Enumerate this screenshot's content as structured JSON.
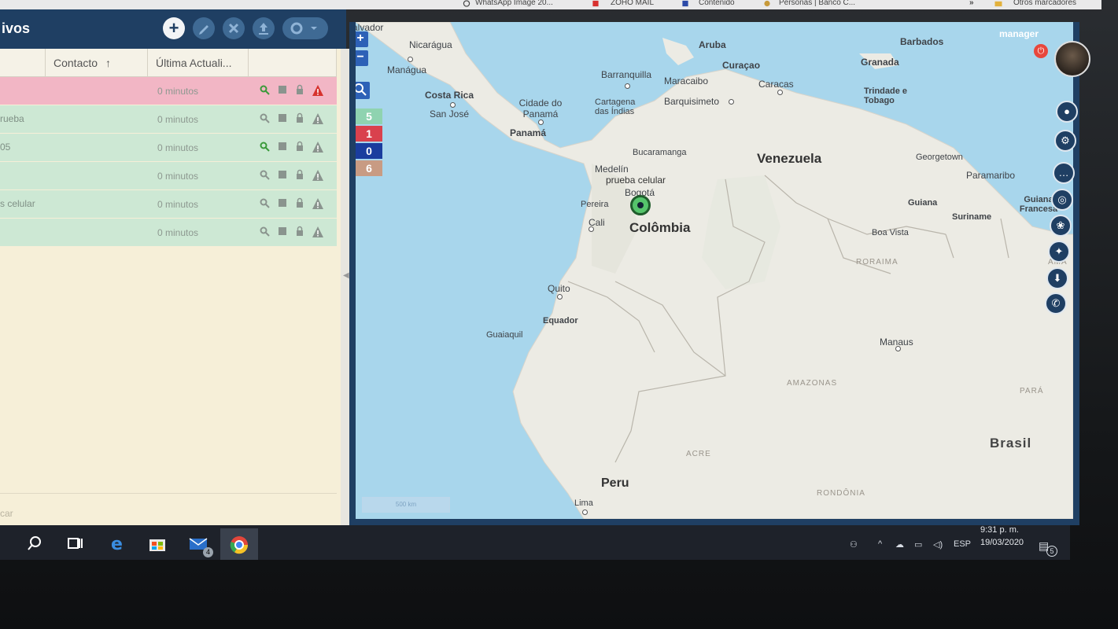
{
  "bookmarks": {
    "items": [
      "WhatsApp Image 20...",
      "ZOHO MAIL",
      "Contenido",
      "Personas | Banco C...",
      "»",
      "Otros marcadores"
    ]
  },
  "app": {
    "title": "ivos",
    "toolbar": {
      "add_icon": "plus-icon",
      "edit_icon": "pencil-icon",
      "delete_icon": "close-icon",
      "upload_icon": "upload-icon",
      "settings_icon": "gear-icon"
    }
  },
  "table": {
    "columns": [
      "Contacto",
      "Última Actuali..."
    ],
    "sort_indicator": "↑",
    "rows": [
      {
        "name": "",
        "time": "0 minutos",
        "status": "alert"
      },
      {
        "name": "rueba",
        "time": "0 minutos",
        "status": "ok"
      },
      {
        "name": "05",
        "time": "0 minutos",
        "status": "ok"
      },
      {
        "name": "",
        "time": "0 minutos",
        "status": "ok"
      },
      {
        "name": "s celular",
        "time": "0 minutos",
        "status": "ok"
      },
      {
        "name": "",
        "time": "0 minutos",
        "status": "ok"
      }
    ],
    "search_placeholder": "car"
  },
  "map": {
    "zoom_in": "+",
    "zoom_out": "−",
    "search_icon": "search-icon",
    "stats": [
      {
        "value": "5",
        "color": "#8fd3b0"
      },
      {
        "value": "1",
        "color": "#d9414d"
      },
      {
        "value": "0",
        "color": "#1a3d9e"
      },
      {
        "value": "6",
        "color": "#c89b83"
      }
    ],
    "scale": "500 km",
    "marker_label": "prueba celular",
    "labels": {
      "salvador": "Salvador",
      "nicaragua": "Nicarágua",
      "managua": "Manágua",
      "costa_rica": "Costa Rica",
      "san_jose": "San José",
      "cidade_panama": "Cidade do Panamá",
      "panama": "Panamá",
      "aruba": "Aruba",
      "curacao": "Curaçao",
      "barbados": "Barbados",
      "granada": "Granada",
      "barranquilla": "Barranquilla",
      "maracaibo": "Maracaibo",
      "caracas": "Caracas",
      "trinidade": "Trindade e Tobago",
      "cartagena": "Cartagena das Índias",
      "barquisimeto": "Barquisimeto",
      "bucaramanga": "Bucaramanga",
      "venezuela": "Venezuela",
      "georgetown": "Georgetown",
      "paramaribo": "Paramaribo",
      "medelin": "Medelín",
      "bogota": "Bogotá",
      "pereira": "Pereira",
      "cali": "Cali",
      "colombia": "Colômbia",
      "guiana": "Guiana",
      "suriname": "Suriname",
      "guiana_francesa": "Guiana Francesa",
      "boa_vista": "Boa Vista",
      "roraima": "RORAIMA",
      "ama": "AMA",
      "quito": "Quito",
      "equador": "Equador",
      "guaiaquil": "Guaiaquil",
      "manaus": "Manaus",
      "amazonas": "AMAZONAS",
      "para": "PARÁ",
      "brasil": "Brasil",
      "acre": "ACRE",
      "rondonia": "RONDÔNIA",
      "peru": "Peru",
      "lima": "Lima"
    }
  },
  "user": {
    "name": "manager",
    "power_icon": "power-icon"
  },
  "side_buttons": [
    "location-icon",
    "gear-icon",
    "chat-icon",
    "target-icon",
    "paw-icon",
    "compass-icon",
    "download-icon",
    "whatsapp-icon"
  ],
  "taskbar": {
    "language": "ESP",
    "time": "9:31 p. m.",
    "date": "19/03/2020",
    "notifications": "5",
    "mail_badge": "4"
  }
}
